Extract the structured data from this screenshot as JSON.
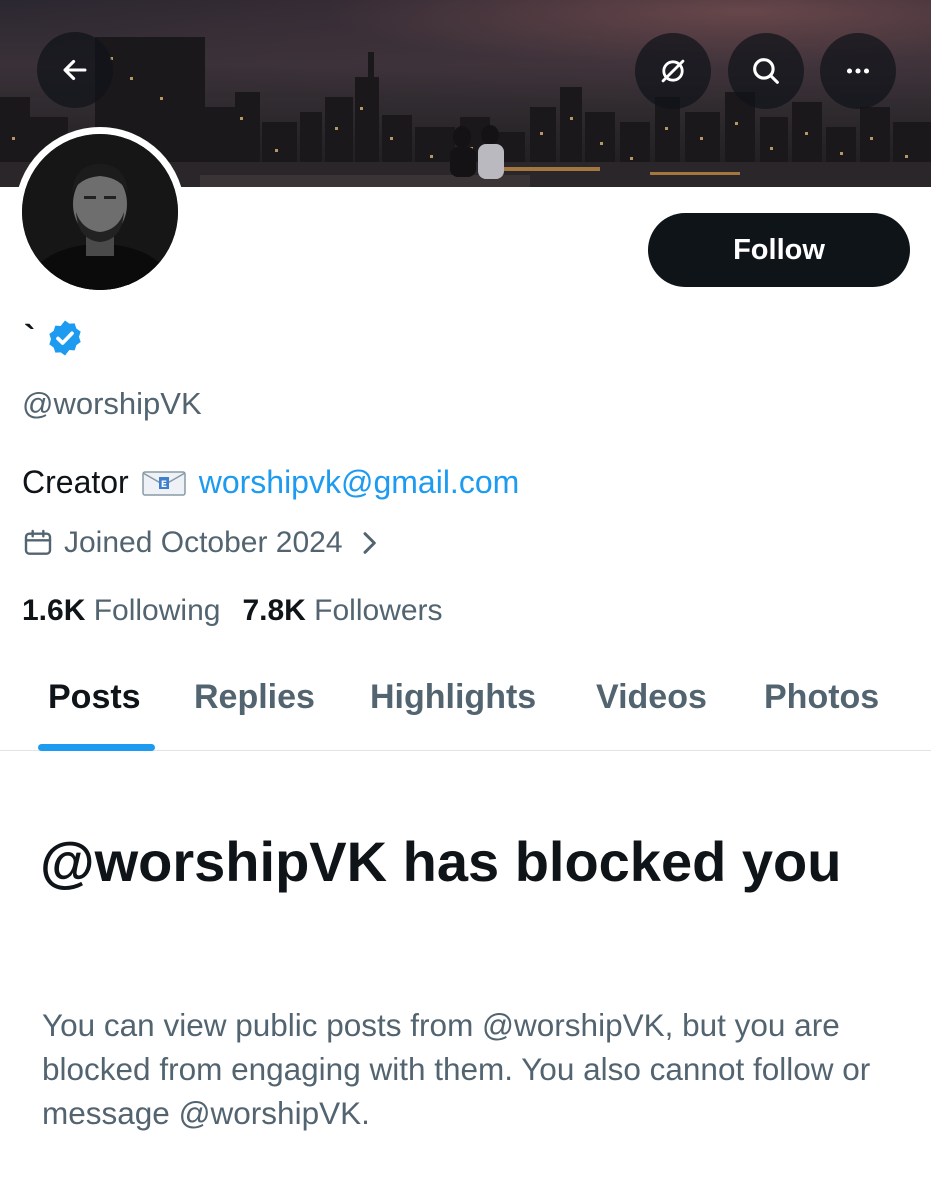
{
  "header": {
    "back_icon": "arrow-left-icon",
    "actions": [
      {
        "name": "grok-icon"
      },
      {
        "name": "search-icon"
      },
      {
        "name": "more-icon"
      }
    ]
  },
  "profile": {
    "display_name": "`",
    "verified": true,
    "handle": "@worshipVK",
    "bio_text": "Creator",
    "bio_emoji": "incoming-envelope-icon",
    "bio_email": "worshipvk@gmail.com",
    "joined": "Joined October 2024",
    "following_count": "1.6K",
    "following_label": "Following",
    "followers_count": "7.8K",
    "followers_label": "Followers",
    "follow_button": "Follow"
  },
  "tabs": [
    {
      "label": "Posts",
      "active": true
    },
    {
      "label": "Replies",
      "active": false
    },
    {
      "label": "Highlights",
      "active": false
    },
    {
      "label": "Videos",
      "active": false
    },
    {
      "label": "Photos",
      "active": false
    }
  ],
  "blocked_notice": {
    "title": "@worshipVK has blocked you",
    "body": "You can view public posts from @worshipVK, but you are blocked from engaging with them. You also cannot follow or message @worshipVK."
  },
  "colors": {
    "accent": "#1d9bf0",
    "text_primary": "#0f1419",
    "text_secondary": "#536471"
  }
}
